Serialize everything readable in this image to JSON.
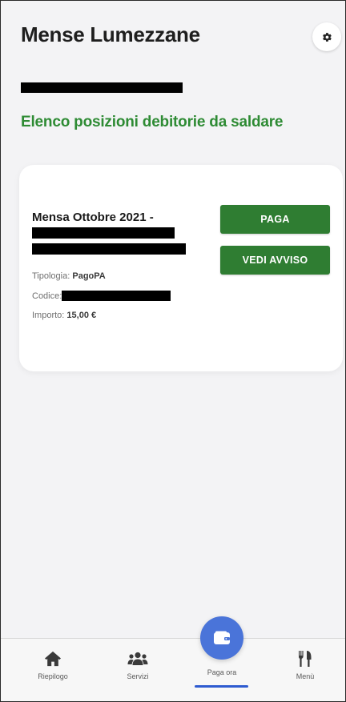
{
  "app": {
    "title": "Mense Lumezzane",
    "section_title": "Elenco posizioni debitorie da saldare"
  },
  "card": {
    "title": "Mensa Ottobre 2021 -",
    "type_label": "Tipologia:",
    "type_value": "PagoPA",
    "code_label": "Codice:",
    "amount_label": "Importo:",
    "amount_value": "15,00 €",
    "pay_button": "PAGA",
    "notice_button": "VEDI AVVISO"
  },
  "nav": {
    "items": [
      {
        "label": "Riepilogo",
        "icon": "home-icon"
      },
      {
        "label": "Servizi",
        "icon": "users-icon"
      },
      {
        "label": "Paga ora",
        "icon": "wallet-icon"
      },
      {
        "label": "Menù",
        "icon": "utensils-icon"
      }
    ]
  },
  "colors": {
    "accent_green": "#2f7d32",
    "subtitle_green": "#2e8b34",
    "fab_blue": "#4a74d9",
    "active_bar": "#2e5bd0"
  }
}
